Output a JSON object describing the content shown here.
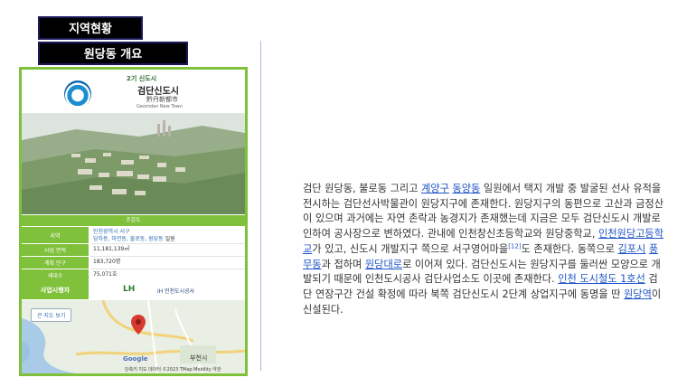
{
  "labels": {
    "region": "지역현황",
    "overview": "원당동 개요"
  },
  "card": {
    "logo_top": "2기 신도시",
    "logo_title": "검단신도시",
    "logo_hanja": "黔丹新都市",
    "logo_en": "Geomdan New Town",
    "table_title": "조감도",
    "rows": [
      {
        "key": "지역",
        "v1": "인천광역시 서구",
        "v2_links": "당하동, 마전동, 불로동, 원당동",
        "v2_tail": " 일원"
      },
      {
        "key": "사업 면적",
        "value": "11,181,139㎡"
      },
      {
        "key": "계획 인구",
        "value": "183,720명"
      },
      {
        "key": "세대수",
        "value": "75,071호"
      }
    ],
    "operator_key": "사업시행자",
    "operator_lh": "LH",
    "operator_ic": "iH 인천도시공사",
    "map_button": "큰 지도 보기",
    "map_city": "부천시",
    "map_google": "Google",
    "map_attr": "단축키  지도 데이터 ©2023 TMap Mobility   약관"
  },
  "paragraph": {
    "t1": "검단 원당동, 불로동 그리고 ",
    "l1": "계양구",
    "t2": " ",
    "l2": "동양동",
    "t3": " 일원에서 택지 개발 중 발굴된 선사 유적을 전시하는 검단선사박물관이 원당지구에 존재한다. 원당지구의 동편으로 고산과 금정산이 있으며 과거에는 자연 촌락과 농경지가 존재했는데 지금은 모두 검단신도시 개발로 인하여 공사장으로 변하였다. 관내에 인천창신초등학교와 원당중학교, ",
    "l3": "인천원당고등학교",
    "t4": "가 있고, 신도시 개발지구 쪽으로 서구영어마을",
    "sup": "[12]",
    "t5": "도 존재한다. 동쪽으로 ",
    "l4": "김포시",
    "t6": " ",
    "l5": "풍무동",
    "t7": "과 접하며 ",
    "l6": "원당대로",
    "t8": "로 이어져 있다. 검단신도시는 원당지구를 둘러싼 모양으로 개발되기 때문에 인천도시공사 검단사업소도 이곳에 존재한다. ",
    "l7": "인천 도시철도 1호선",
    "t9": " 검단 연장구간 건설 확정에 따라 북쪽 검단신도시 2단계 상업지구에 동명을 딴 ",
    "l8": "원당역",
    "t10": "이 신설된다."
  },
  "colors": {
    "accent_green": "#7fc13a",
    "link_blue": "#1f55c7",
    "label_bg": "#000000"
  }
}
